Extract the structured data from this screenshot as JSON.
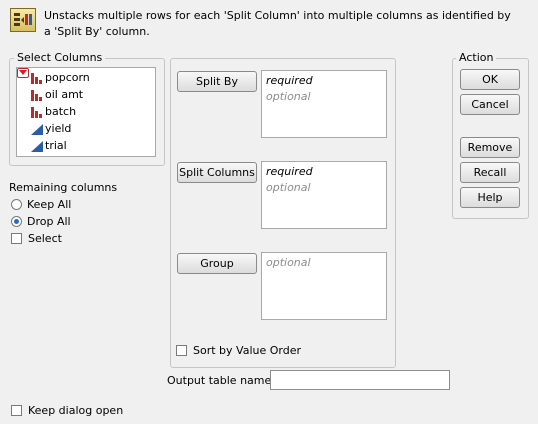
{
  "header": {
    "description": "Unstacks multiple rows for each 'Split Column' into multiple columns as identified by a 'Split By' column."
  },
  "select_columns": {
    "title": "Select Columns",
    "columns": [
      {
        "name": "popcorn",
        "icon": "nominal-bar-icon"
      },
      {
        "name": "oil amt",
        "icon": "nominal-bar-icon"
      },
      {
        "name": "batch",
        "icon": "nominal-bar-icon"
      },
      {
        "name": "yield",
        "icon": "continuous-triangle-icon"
      },
      {
        "name": "trial",
        "icon": "continuous-triangle-icon"
      }
    ]
  },
  "remaining_columns": {
    "label": "Remaining columns",
    "options": [
      "Keep All",
      "Drop All"
    ],
    "selected": "Drop All",
    "select_label": "Select"
  },
  "roles": {
    "split_by": {
      "button": "Split By",
      "required": "required",
      "optional": "optional"
    },
    "split_columns": {
      "button": "Split Columns",
      "required": "required",
      "optional": "optional"
    },
    "group": {
      "button": "Group",
      "optional": "optional"
    },
    "sort_label": "Sort by Value Order"
  },
  "output": {
    "label": "Output table name:",
    "value": ""
  },
  "action": {
    "title": "Action",
    "ok": "OK",
    "cancel": "Cancel",
    "remove": "Remove",
    "recall": "Recall",
    "help": "Help"
  },
  "footer": {
    "keep_open": "Keep dialog open"
  },
  "colors": {
    "nominal_icon": "#b52d2d",
    "continuous_icon": "#2b5ea8",
    "radio_accent": "#2a6bc1",
    "optional_text": "#8c8c8c"
  }
}
